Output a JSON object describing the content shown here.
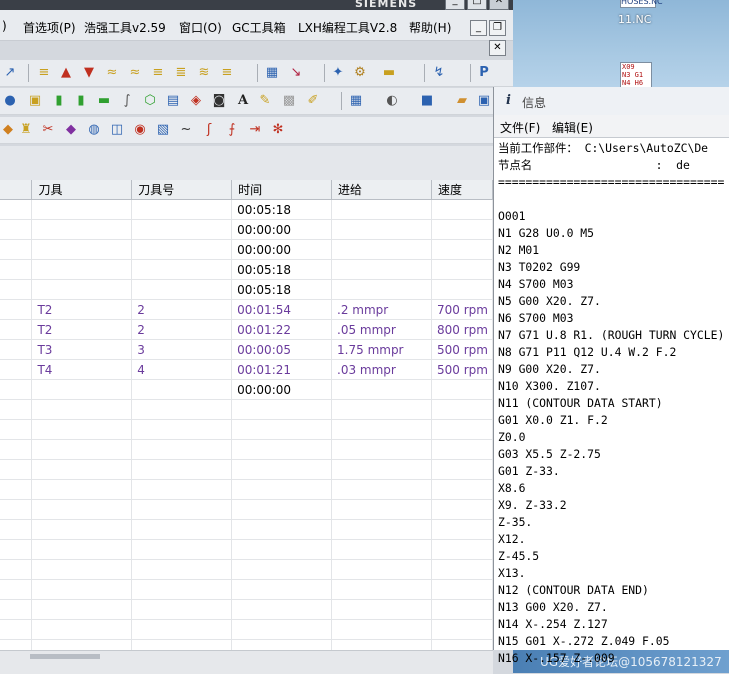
{
  "app": {
    "brand": "SIEMENS"
  },
  "menubar": {
    "partial_left": ")",
    "items": [
      "首选项(P)",
      "浩强工具v2.59",
      "窗口(O)",
      "GC工具箱",
      "LXH编程工具V2.8",
      "帮助(H)"
    ]
  },
  "window_controls": {
    "minimize": "_",
    "maximize": "□",
    "close": "✕"
  },
  "mdi_controls": {
    "minimize": "_",
    "restore": "❐",
    "close": "✕"
  },
  "toolbar_icons": {
    "text_tool": "A"
  },
  "table": {
    "headers": [
      "",
      "刀具",
      "刀具号",
      "时间",
      "进给",
      "速度"
    ],
    "rows": [
      {
        "tool": "",
        "tool_no": "",
        "time": "00:05:18",
        "feed": "",
        "speed": ""
      },
      {
        "tool": "",
        "tool_no": "",
        "time": "00:00:00",
        "feed": "",
        "speed": ""
      },
      {
        "tool": "",
        "tool_no": "",
        "time": "00:00:00",
        "feed": "",
        "speed": ""
      },
      {
        "tool": "",
        "tool_no": "",
        "time": "00:05:18",
        "feed": "",
        "speed": ""
      },
      {
        "tool": "",
        "tool_no": "",
        "time": "00:05:18",
        "feed": "",
        "speed": ""
      },
      {
        "tool": "T2",
        "tool_no": "2",
        "time": "00:01:54",
        "feed": ".2 mmpr",
        "speed": "700 rpm"
      },
      {
        "tool": "T2",
        "tool_no": "2",
        "time": "00:01:22",
        "feed": ".05 mmpr",
        "speed": "800 rpm"
      },
      {
        "tool": "T3",
        "tool_no": "3",
        "time": "00:00:05",
        "feed": "1.75 mmpr",
        "speed": "500 rpm"
      },
      {
        "tool": "T4",
        "tool_no": "4",
        "time": "00:01:21",
        "feed": ".03 mmpr",
        "speed": "500 rpm"
      },
      {
        "tool": "",
        "tool_no": "",
        "time": "00:00:00",
        "feed": "",
        "speed": ""
      }
    ],
    "op_color": "#6a3b9c"
  },
  "desktop": {
    "file_top_label": "HOSES.NC",
    "file_label": "11.NC",
    "file_preview": [
      "X09",
      "N3 G1",
      "N4 H6"
    ],
    "watermark": "UG爱好者论坛@105678121327"
  },
  "info": {
    "title": "信息",
    "menu": [
      "文件(F)",
      "编辑(E)"
    ],
    "lines": [
      "当前工作部件： C:\\Users\\AutoZC\\De",
      "节点名                  :  de",
      "=================================",
      "",
      "O001",
      "N1 G28 U0.0 M5",
      "N2 M01",
      "N3 T0202 G99",
      "N4 S700 M03",
      "N5 G00 X20. Z7.",
      "N6 S700 M03",
      "N7 G71 U.8 R1. (ROUGH TURN CYCLE)",
      "N8 G71 P11 Q12 U.4 W.2 F.2",
      "N9 G00 X20. Z7.",
      "N10 X300. Z107.",
      "N11 (CONTOUR DATA START)",
      "G01 X0.0 Z1. F.2",
      "Z0.0",
      "G03 X5.5 Z-2.75",
      "G01 Z-33.",
      "X8.6",
      "X9. Z-33.2",
      "Z-35.",
      "X12.",
      "Z-45.5",
      "X13.",
      "N12 (CONTOUR DATA END)",
      "N13 G00 X20. Z7.",
      "N14 X-.254 Z.127",
      "N15 G01 X-.272 Z.049 F.05",
      "N16 X-.157 Z-.009"
    ]
  }
}
